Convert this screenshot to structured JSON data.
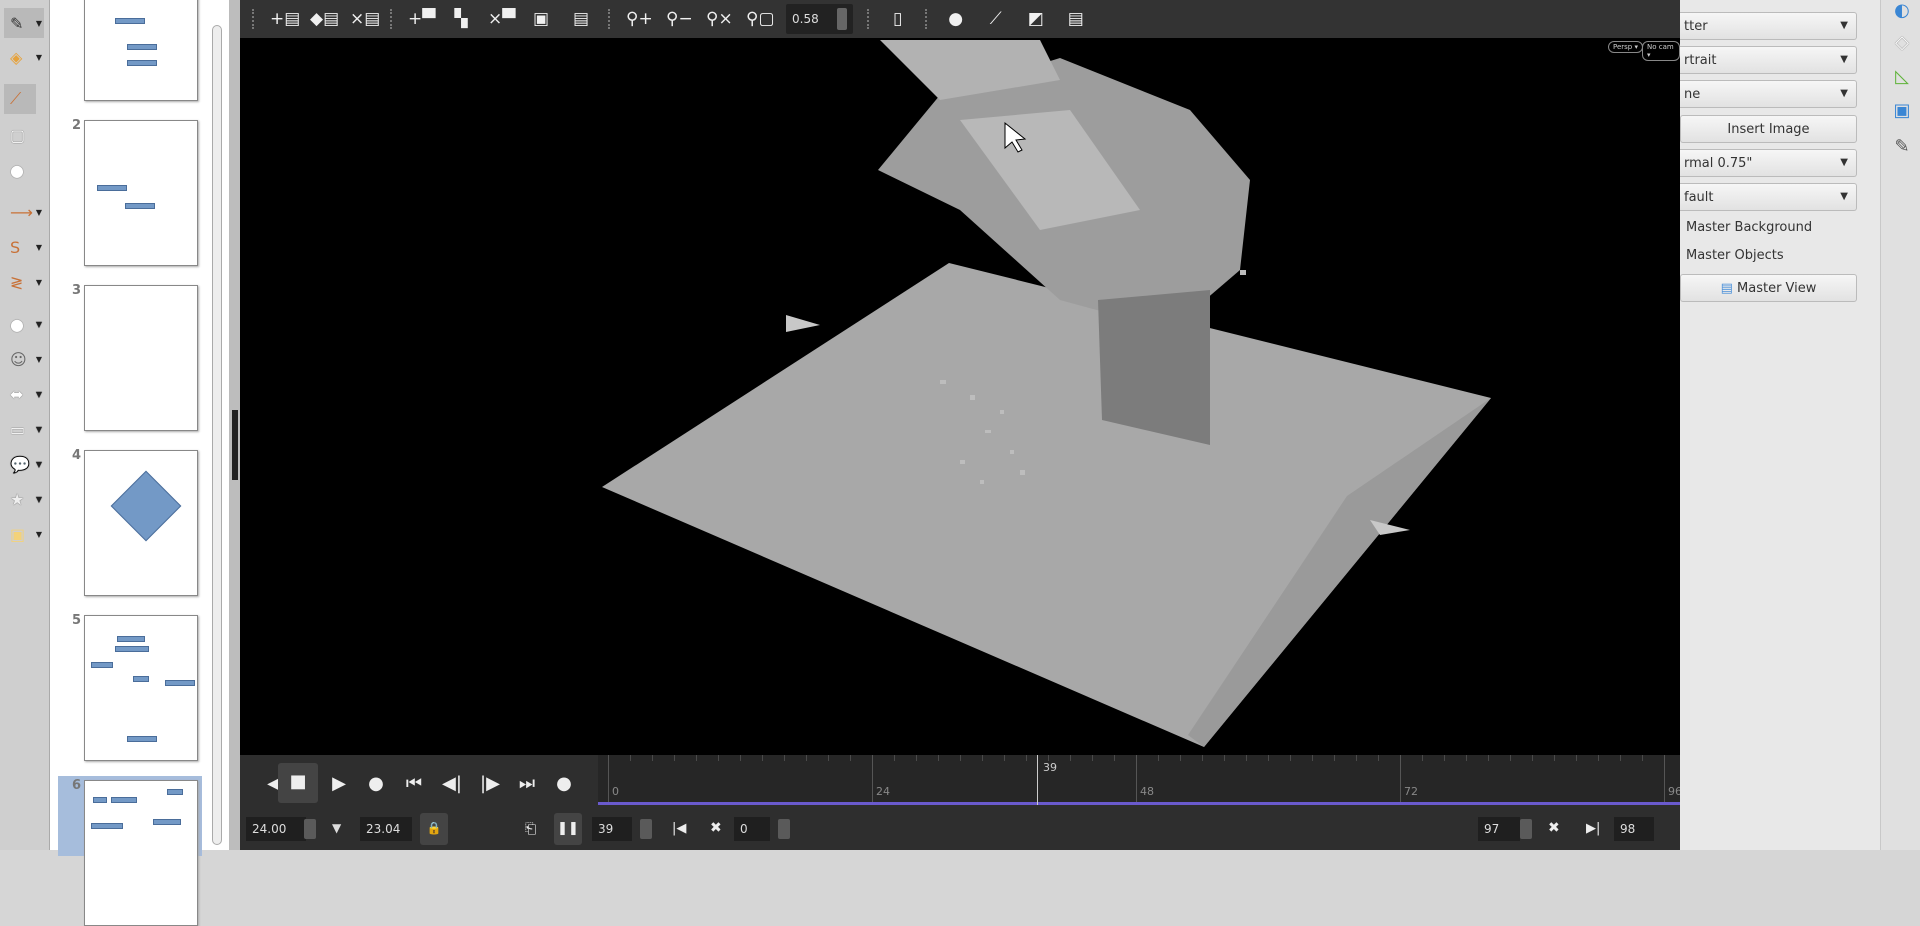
{
  "left_toolbar": {
    "tools": [
      {
        "icon": "line-color-icon"
      },
      {
        "icon": "fill-color-icon"
      },
      {
        "icon": "line-icon"
      },
      {
        "icon": "rectangle-icon"
      },
      {
        "icon": "ellipse-icon"
      },
      {
        "icon": "arrow-line-icon"
      },
      {
        "icon": "curve-icon"
      },
      {
        "icon": "connector-icon"
      },
      {
        "icon": "basic-shapes-icon"
      },
      {
        "icon": "symbol-shapes-icon"
      },
      {
        "icon": "block-arrows-icon"
      },
      {
        "icon": "flowchart-icon"
      },
      {
        "icon": "callout-icon"
      },
      {
        "icon": "star-icon"
      },
      {
        "icon": "3d-objects-icon"
      }
    ]
  },
  "slides": {
    "numbers": [
      "2",
      "3",
      "4",
      "5",
      "6"
    ],
    "selected": "6"
  },
  "viewport_toolbar": {
    "zoom_value": "0.58"
  },
  "viewport": {
    "camera_chips": [
      "Persp ▾",
      "No cam ▾"
    ]
  },
  "timeline": {
    "fps": "24.00",
    "time": "23.04",
    "current_frame": "39",
    "start_offset": "0",
    "end_frame": "97",
    "last_frame": "98",
    "ruler_labels": [
      "0",
      "24",
      "48",
      "72",
      "96"
    ],
    "playhead_label": "39",
    "ruler_max": 96,
    "playhead": 39,
    "range_color": "#6a5acd"
  },
  "right_panel": {
    "format": "tter",
    "orientation": "rtrait",
    "background": "ne",
    "insert_image": "Insert Image",
    "margins": "rmal 0.75\"",
    "master": "fault",
    "master_background": "Master Background",
    "master_objects": "Master Objects",
    "master_view": "Master View"
  },
  "deck": {
    "icons": [
      "properties-icon",
      "styles-icon",
      "shapes-icon",
      "gallery-icon",
      "navigator-icon"
    ]
  }
}
